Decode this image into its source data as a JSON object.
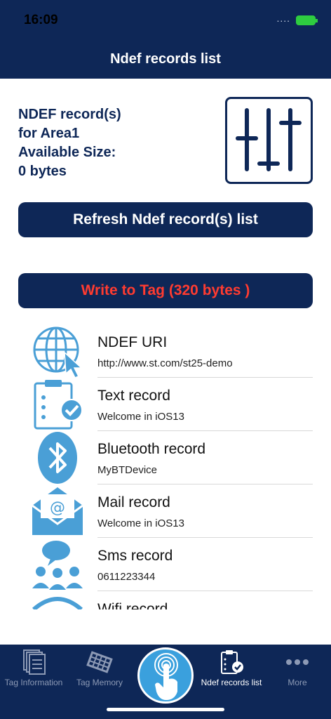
{
  "status": {
    "time": "16:09",
    "signal": "...."
  },
  "nav": {
    "title": "Ndef records list"
  },
  "area": {
    "line1": "NDEF record(s)",
    "line2": "for Area1",
    "line3": "Available Size:",
    "line4": "0 bytes"
  },
  "buttons": {
    "refresh": "Refresh Ndef record(s) list",
    "write": "Write to Tag (320 bytes )"
  },
  "records": [
    {
      "title": "NDEF URI",
      "subtitle": "http://www.st.com/st25-demo",
      "icon": "globe-cursor-icon"
    },
    {
      "title": "Text record",
      "subtitle": "Welcome in iOS13",
      "icon": "clipboard-check-icon"
    },
    {
      "title": "Bluetooth record",
      "subtitle": "MyBTDevice",
      "icon": "bluetooth-icon"
    },
    {
      "title": "Mail record",
      "subtitle": "Welcome in iOS13",
      "icon": "mail-icon"
    },
    {
      "title": "Sms record",
      "subtitle": "0611223344",
      "icon": "sms-people-icon"
    },
    {
      "title": "Wifi record",
      "subtitle": "",
      "icon": "wifi-icon"
    }
  ],
  "tabs": [
    {
      "label": "Tag Information",
      "icon": "documents-icon"
    },
    {
      "label": "Tag Memory",
      "icon": "memory-chip-icon"
    },
    {
      "label": "Ndef records list",
      "icon": "clipboard-check-icon"
    },
    {
      "label": "More",
      "icon": "more-dots-icon"
    }
  ],
  "colors": {
    "navy": "#0e2757",
    "accent_blue": "#3aa0dd",
    "write_red": "#ff3b30",
    "icon_blue": "#4a9fd6"
  }
}
